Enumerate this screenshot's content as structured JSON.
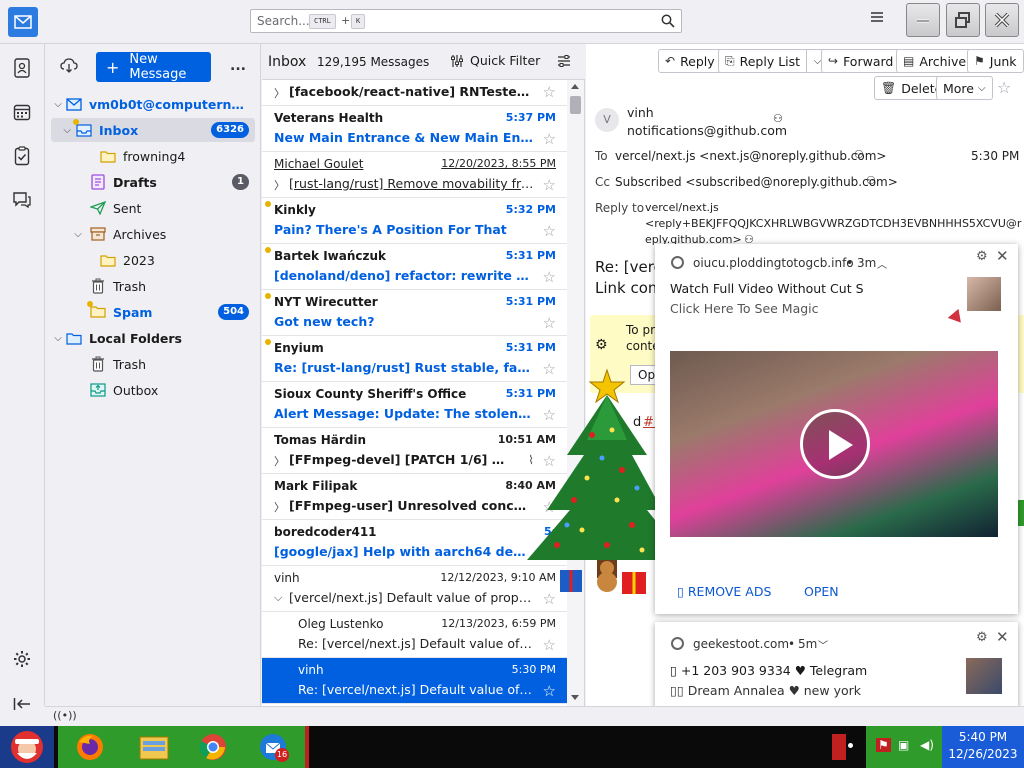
{
  "search": {
    "placeholder": "Search...",
    "kbd1": "CTRL",
    "plus": "+",
    "kbd2": "K"
  },
  "folders": {
    "new_message_label": "New Message",
    "more": "...",
    "account": "vm0b0t@computernewb...",
    "items": [
      {
        "label": "Inbox",
        "badge": "6326"
      },
      {
        "label": "frowning4"
      },
      {
        "label": "Drafts",
        "badge": "1"
      },
      {
        "label": "Sent"
      },
      {
        "label": "Archives"
      },
      {
        "label": "2023"
      },
      {
        "label": "Trash"
      },
      {
        "label": "Spam",
        "badge": "504"
      },
      {
        "label": "Local Folders"
      },
      {
        "label": "Trash"
      },
      {
        "label": "Outbox"
      }
    ]
  },
  "thread": {
    "folder_name": "Inbox",
    "count": "129,195 Messages",
    "quick_filter": "Quick Filter",
    "rows": [
      {
        "sender": "",
        "date": "",
        "subject": "[facebook/react-native] RNTester iOS:..."
      },
      {
        "sender": "Veterans Health",
        "date": "5:37 PM",
        "subject": "New Main Entrance & New Main Entry ..."
      },
      {
        "sender": "Michael Goulet",
        "date": "12/20/2023, 8:55 PM",
        "subject": "[rust-lang/rust] Remove movability from..."
      },
      {
        "sender": "Kinkly",
        "date": "5:32 PM",
        "subject": "Pain? There's A Position For That"
      },
      {
        "sender": "Bartek Iwańczuk",
        "date": "5:31 PM",
        "subject": "[denoland/deno] refactor: rewrite rema..."
      },
      {
        "sender": "NYT Wirecutter",
        "date": "5:31 PM",
        "subject": "Got new tech?"
      },
      {
        "sender": "Enyium",
        "date": "5:31 PM",
        "subject": "Re: [rust-lang/rust] Rust stable, fatal ru..."
      },
      {
        "sender": "Sioux County Sheriff's Office",
        "date": "5:31 PM",
        "subject": "Alert Message: Update: The stolen gree..."
      },
      {
        "sender": "Tomas Härdin",
        "date": "10:51 AM",
        "subject": "[FFmpeg-devel] [PATCH 1/6] doc/..."
      },
      {
        "sender": "Mark Filipak",
        "date": "8:40 AM",
        "subject": "[FFmpeg-user] Unresolved concatena..."
      },
      {
        "sender": "boredcoder411",
        "date": "5:",
        "subject": "[google/jax] Help with aarch64 depend..."
      },
      {
        "sender": "vinh",
        "date": "12/12/2023, 9:10 AM",
        "subject": "[vercel/next.js] Default value of property..."
      },
      {
        "sender": "Oleg Lustenko",
        "date": "12/13/2023, 6:59 PM",
        "subject": "Re: [vercel/next.js] Default value of pro..."
      },
      {
        "sender": "vinh",
        "date": "5:30 PM",
        "subject": "Re: [vercel/next.js] Default value of pro..."
      }
    ]
  },
  "message": {
    "buttons": {
      "reply": "Reply",
      "reply_list": "Reply List",
      "forward": "Forward",
      "archive": "Archive",
      "junk": "Junk",
      "delete": "Delete",
      "more": "More"
    },
    "avatar_letter": "V",
    "from_name": "vinh",
    "from_email": "notifications@github.com",
    "to_label": "To",
    "to_value": "vercel/next.js <next.js@noreply.github.com>",
    "time": "5:30 PM",
    "cc_label": "Cc",
    "cc_value": "Subscribed <subscribed@noreply.github.com>",
    "replyto_label": "Reply to",
    "replyto_line1": "vercel/next.js",
    "replyto_line2": "<reply+BEKJFFQQJKCXHRLWBGVWRZGDTCDH3EVBNHHHS5XCVU@r",
    "replyto_line3": "eply.github.com>",
    "subject_partial": "Re: [verc",
    "link_partial": "Link com",
    "banner_line1": "To pr",
    "banner_line2": "conte",
    "banner_btn": "Op",
    "body_partial": "d",
    "body_link": "#!"
  },
  "ad1": {
    "domain": "oiucu.ploddingtotogcb.info",
    "age": "3m",
    "title": "Watch Full Video Without Cut S",
    "sub": "Click Here To See Magic",
    "remove_ads": "REMOVE ADS",
    "open": "OPEN"
  },
  "ad2": {
    "domain": "geekestoot.com",
    "age": "5m",
    "line1": "+1 203 903 9334 ♥ Telegram",
    "line2": "Dream Annalea ♥ new york"
  },
  "clock": {
    "time": "5:40 PM",
    "date": "12/26/2023"
  },
  "taskbar": {
    "thunderbird_badge": "16"
  }
}
